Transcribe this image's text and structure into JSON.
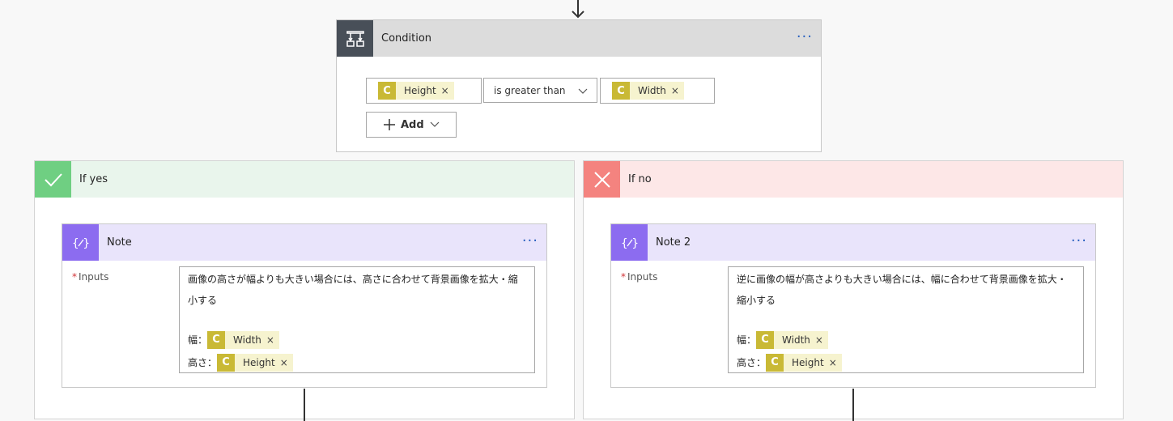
{
  "condition": {
    "title": "Condition",
    "more": "···",
    "left_token": {
      "icon": "C",
      "label": "Height",
      "remove": "×"
    },
    "operator": "is greater than",
    "right_token": {
      "icon": "C",
      "label": "Width",
      "remove": "×"
    },
    "add_label": "Add"
  },
  "if_yes": {
    "title": "If yes",
    "note": {
      "title": "Note",
      "more": "···",
      "inputs_required": "*",
      "inputs_label": "Inputs",
      "text_line1": "画像の高さが幅よりも大きい場合には、高さに合わせて背景画像を拡大・縮",
      "text_line2": "小する",
      "width_prefix": "幅：",
      "height_prefix": "高さ：",
      "width_token": {
        "icon": "C",
        "label": "Width",
        "remove": "×"
      },
      "height_token": {
        "icon": "C",
        "label": "Height",
        "remove": "×"
      }
    }
  },
  "if_no": {
    "title": "If no",
    "note": {
      "title": "Note 2",
      "more": "···",
      "inputs_required": "*",
      "inputs_label": "Inputs",
      "text_line1": "逆に画像の幅が高さよりも大きい場合には、幅に合わせて背景画像を拡大・",
      "text_line2": "縮小する",
      "width_prefix": "幅：",
      "height_prefix": "高さ：",
      "width_token": {
        "icon": "C",
        "label": "Width",
        "remove": "×"
      },
      "height_token": {
        "icon": "C",
        "label": "Height",
        "remove": "×"
      }
    }
  },
  "colors": {
    "condition_header": "#dcdcdc",
    "condition_icon": "#484f58",
    "yes_header": "#e9f5ec",
    "yes_icon": "#6fcf82",
    "no_header": "#fde7e7",
    "no_icon": "#f4837f",
    "note_header": "#e9e4fb",
    "note_icon": "#8c6cf0",
    "token_icon": "#c9b935",
    "token_bg": "#f6f3cf",
    "accent": "#2b62c0"
  }
}
